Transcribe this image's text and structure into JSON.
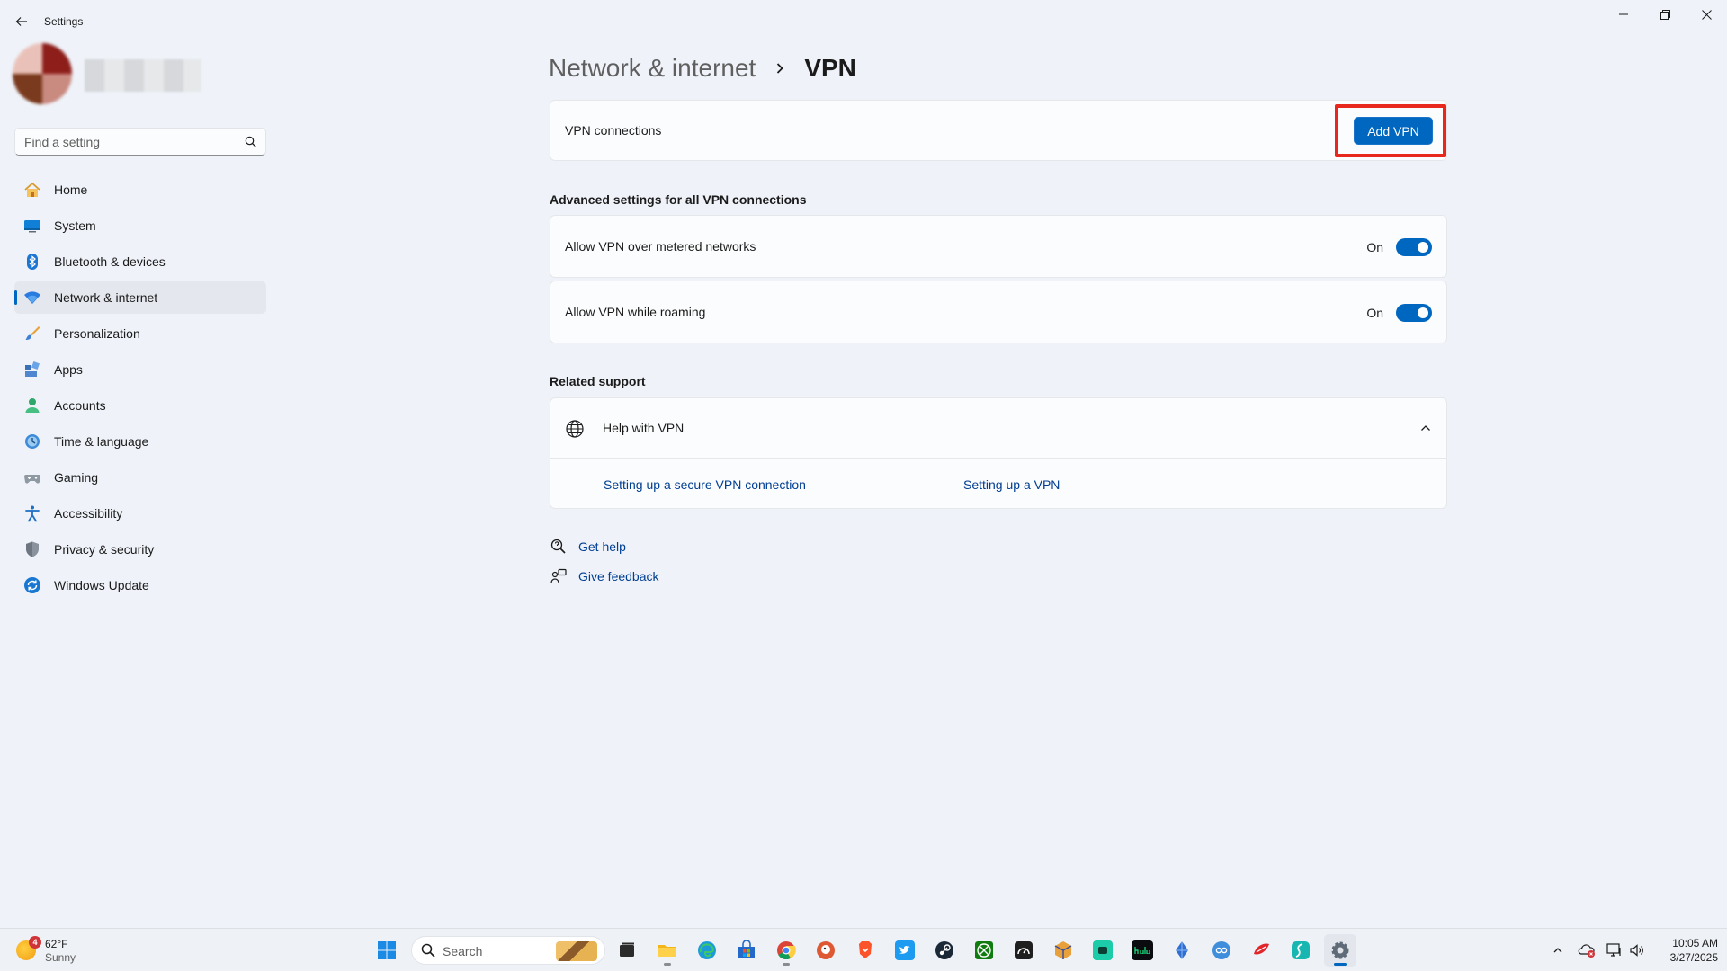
{
  "window": {
    "title": "Settings"
  },
  "search": {
    "placeholder": "Find a setting"
  },
  "nav": {
    "items": [
      {
        "label": "Home",
        "icon": "home-icon"
      },
      {
        "label": "System",
        "icon": "system-icon"
      },
      {
        "label": "Bluetooth & devices",
        "icon": "bluetooth-icon"
      },
      {
        "label": "Network & internet",
        "icon": "network-icon",
        "active": true
      },
      {
        "label": "Personalization",
        "icon": "personalization-icon"
      },
      {
        "label": "Apps",
        "icon": "apps-icon"
      },
      {
        "label": "Accounts",
        "icon": "accounts-icon"
      },
      {
        "label": "Time & language",
        "icon": "time-language-icon"
      },
      {
        "label": "Gaming",
        "icon": "gaming-icon"
      },
      {
        "label": "Accessibility",
        "icon": "accessibility-icon"
      },
      {
        "label": "Privacy & security",
        "icon": "privacy-security-icon"
      },
      {
        "label": "Windows Update",
        "icon": "windows-update-icon"
      }
    ]
  },
  "breadcrumb": {
    "parent": "Network & internet",
    "current": "VPN"
  },
  "vpn": {
    "connections_label": "VPN connections",
    "add_button": "Add VPN"
  },
  "advanced": {
    "title": "Advanced settings for all VPN connections",
    "metered": {
      "label": "Allow VPN over metered networks",
      "state": "On"
    },
    "roaming": {
      "label": "Allow VPN while roaming",
      "state": "On"
    }
  },
  "related": {
    "title": "Related support",
    "help_title": "Help with VPN",
    "links": [
      "Setting up a secure VPN connection",
      "Setting up a VPN"
    ]
  },
  "footer": {
    "get_help": "Get help",
    "give_feedback": "Give feedback"
  },
  "taskbar": {
    "weather": {
      "temp": "62°F",
      "condition": "Sunny",
      "badge": "4"
    },
    "search_label": "Search",
    "clock": {
      "time": "10:05 AM",
      "date": "3/27/2025"
    }
  },
  "colors": {
    "accent": "#0067c0",
    "highlight": "#e8281c",
    "link": "#003e92"
  }
}
